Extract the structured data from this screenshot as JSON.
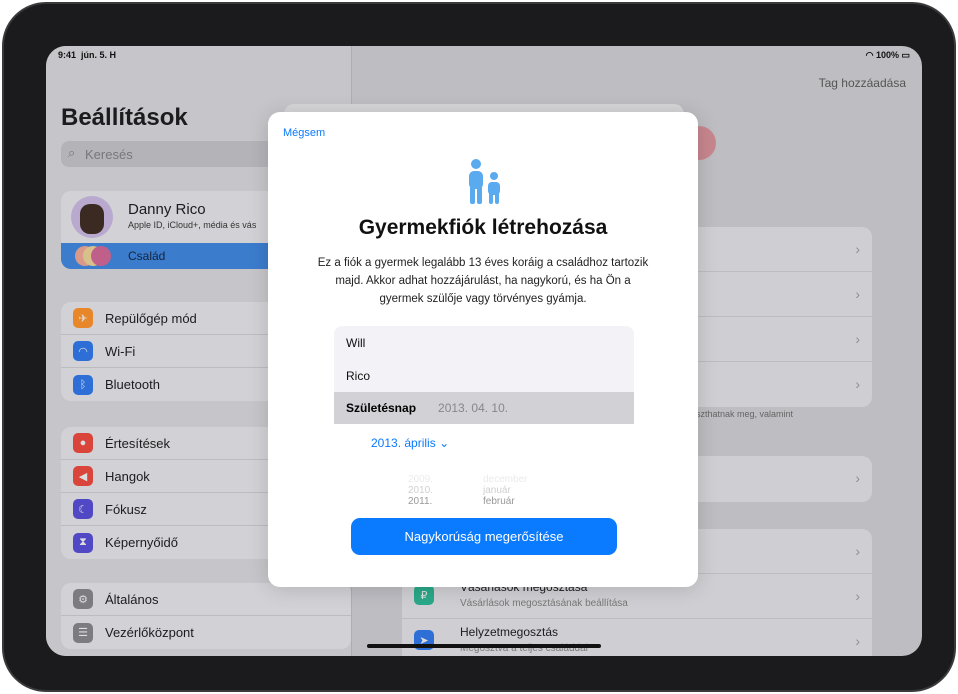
{
  "status": {
    "time": "9:41",
    "date": "jún. 5. H",
    "battery": "100%"
  },
  "sidebar": {
    "title": "Beállítások",
    "search_placeholder": "Keresés",
    "profile": {
      "name": "Danny Rico",
      "subtitle": "Apple ID, iCloud+, média és vás"
    },
    "family": "Család",
    "groups": [
      [
        {
          "label": "Repülőgép mód",
          "icon": "airplane-icon",
          "color": "#e8862a"
        },
        {
          "label": "Wi-Fi",
          "icon": "wifi-icon",
          "color": "#2d6fd6"
        },
        {
          "label": "Bluetooth",
          "icon": "bluetooth-icon",
          "color": "#2d6fd6"
        }
      ],
      [
        {
          "label": "Értesítések",
          "icon": "bell-icon",
          "color": "#d9443b"
        },
        {
          "label": "Hangok",
          "icon": "speaker-icon",
          "color": "#d9443b"
        },
        {
          "label": "Fókusz",
          "icon": "moon-icon",
          "color": "#5048c4"
        },
        {
          "label": "Képernyőidő",
          "icon": "hourglass-icon",
          "color": "#5048c4"
        }
      ],
      [
        {
          "label": "Általános",
          "icon": "gear-icon",
          "color": "#7b7b80"
        },
        {
          "label": "Vezérlőközpont",
          "icon": "switches-icon",
          "color": "#7b7b80"
        }
      ]
    ]
  },
  "detail": {
    "add_member": "Tag hozzáadása",
    "footer_text": "t oszthatnak meg, valamint",
    "purchase_sharing": {
      "title": "Vásárlások megosztása",
      "subtitle": "Vásárlások megosztásának beállítása"
    },
    "location_sharing": {
      "title": "Helyzetmegosztás",
      "subtitle": "Megosztva a teljes családdal"
    }
  },
  "modal": {
    "cancel": "Mégsem",
    "title": "Gyermekfiók létrehozása",
    "description": "Ez a fiók a gyermek legalább 13 éves koráig a családhoz tartozik majd. Akkor adhat hozzájárulást, ha nagykorú, és ha Ön a gyermek szülője vagy törvényes gyámja.",
    "first_name": "Will",
    "last_name": "Rico",
    "birthday_label": "Születésnap",
    "birthday_value": "2013. 04. 10.",
    "month_selector": "2013. április",
    "picker": [
      {
        "year": "2009.",
        "month": "december"
      },
      {
        "year": "2010.",
        "month": "január"
      },
      {
        "year": "2011.",
        "month": "február"
      }
    ],
    "confirm": "Nagykorúság megerősítése"
  }
}
